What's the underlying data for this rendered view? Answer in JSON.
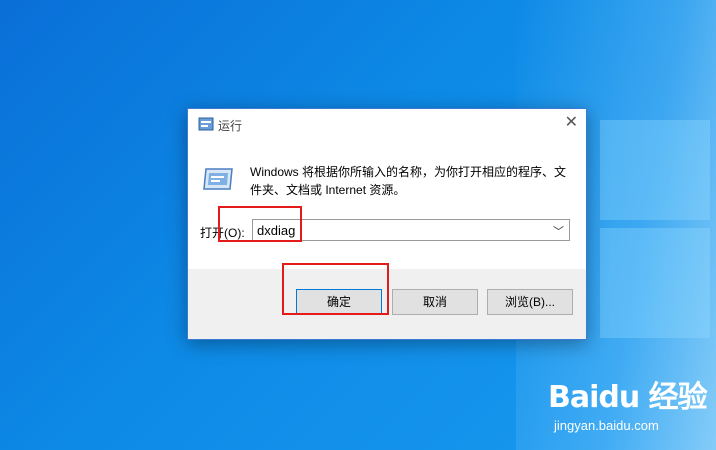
{
  "dialog": {
    "title": "运行",
    "description": "Windows 将根据你所输入的名称，为你打开相应的程序、文件夹、文档或 Internet 资源。",
    "open_label": "打开(O):",
    "open_value": "dxdiag",
    "buttons": {
      "ok": "确定",
      "cancel": "取消",
      "browse": "浏览(B)..."
    }
  },
  "watermark": {
    "logo": "Baidu 经验",
    "url": "jingyan.baidu.com"
  },
  "colors": {
    "desktop": "#0d8ae6",
    "highlight": "#e41b1b",
    "accent": "#0078d7"
  }
}
